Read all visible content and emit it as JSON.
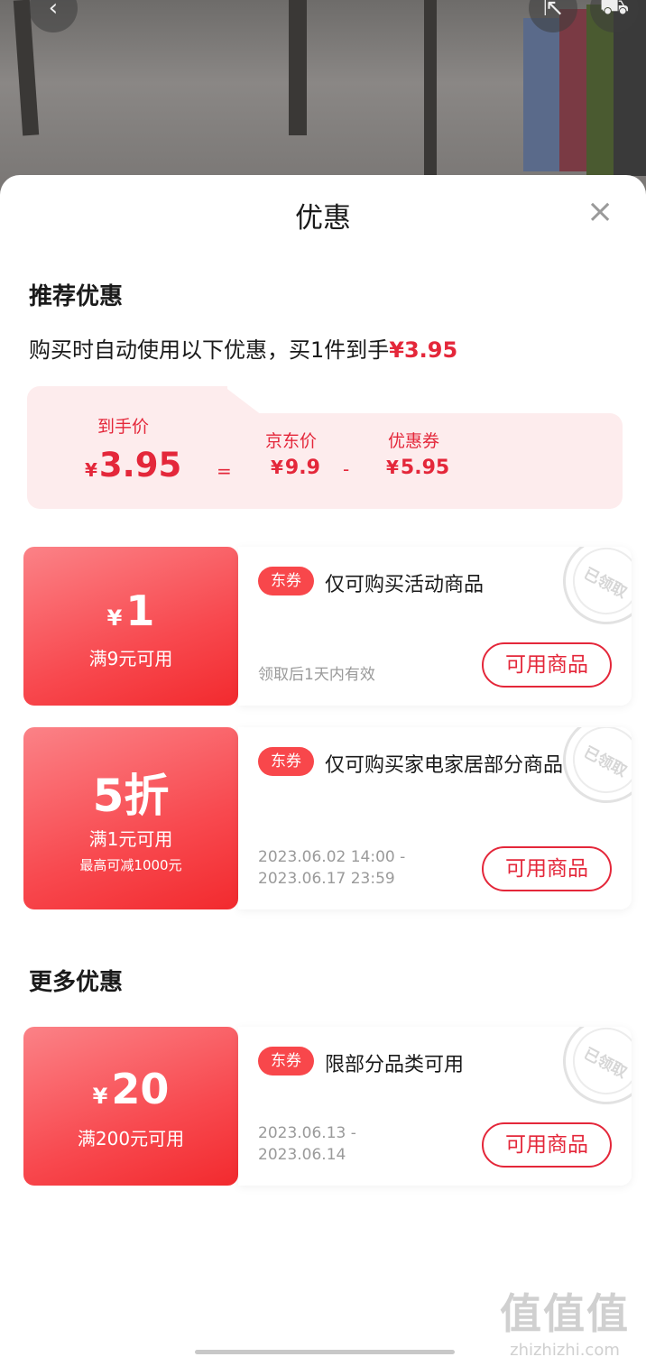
{
  "sheet": {
    "title": "优惠",
    "close_icon": "close-icon"
  },
  "recommended": {
    "heading": "推荐优惠",
    "desc_prefix": "购买时自动使用以下优惠，买1件到手",
    "desc_price": "¥3.95",
    "breakdown": {
      "final_label": "到手价",
      "final_value": "3.95",
      "eq": "=",
      "jd_label": "京东价",
      "jd_value": "9.9",
      "minus": "-",
      "coupon_label": "优惠券",
      "coupon_value": "5.95",
      "currency": "¥"
    }
  },
  "coupons": [
    {
      "amount": "1",
      "currency": "¥",
      "condition": "满9元可用",
      "tag": "东券",
      "title": "仅可购买活动商品",
      "validity": "领取后1天内有效",
      "button": "可用商品",
      "stamp": "已领取"
    },
    {
      "amount": "5折",
      "condition": "满1元可用",
      "max_discount": "最高可减1000元",
      "tag": "东券",
      "title": "仅可购买家电家居部分商品",
      "validity_line1": "2023.06.02  14:00  -",
      "validity_line2": "2023.06.17  23:59",
      "button": "可用商品",
      "stamp": "已领取"
    }
  ],
  "more": {
    "heading": "更多优惠",
    "coupons": [
      {
        "amount": "20",
        "currency": "¥",
        "condition": "满200元可用",
        "tag": "东券",
        "title": "限部分品类可用",
        "validity_line1": "2023.06.13  -",
        "validity_line2": "2023.06.14",
        "button": "可用商品",
        "stamp": "已领取"
      }
    ]
  },
  "watermark": {
    "main": "值值值",
    "sub": "zhizhizhi.com"
  },
  "colors": {
    "accent": "#e4273a",
    "coupon_gradient_end": "#f22a2e",
    "breakdown_bg": "#fdeced"
  }
}
